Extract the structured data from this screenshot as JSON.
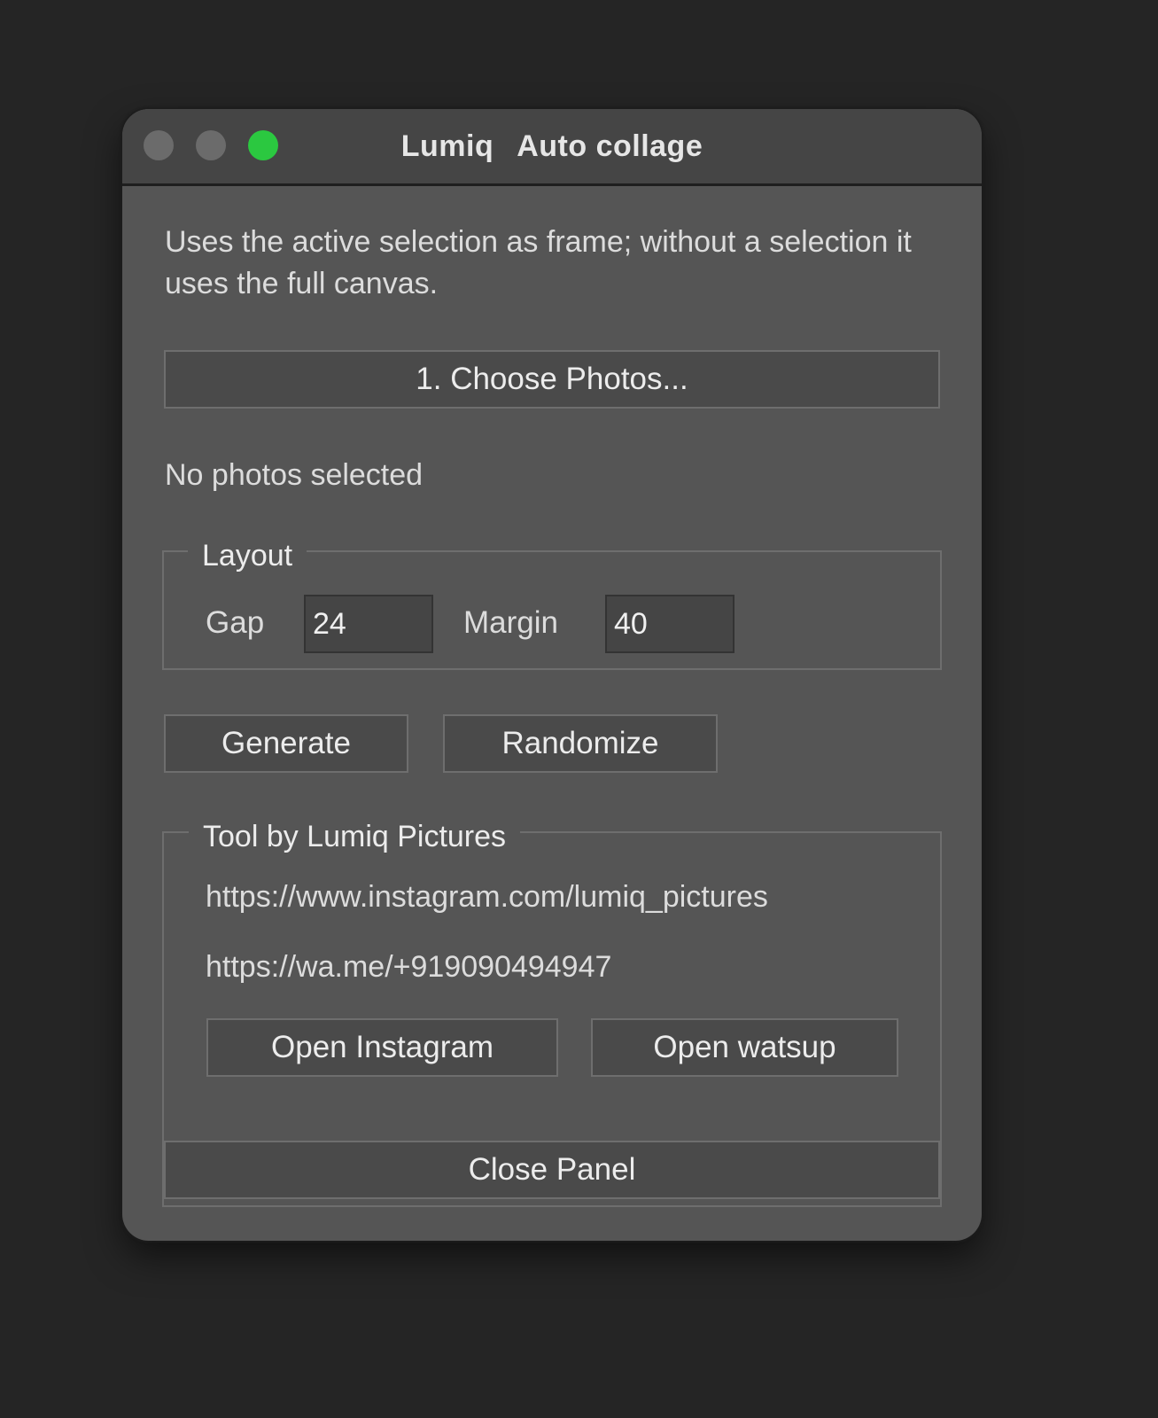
{
  "window": {
    "title_part1": "Lumiq",
    "title_part2": "Auto collage"
  },
  "description": "Uses the active selection as frame; without a selection it uses the full canvas.",
  "choose_button_label": "1. Choose Photos...",
  "status_text": "No photos selected",
  "layout": {
    "legend": "Layout",
    "gap_label": "Gap",
    "gap_value": "24",
    "margin_label": "Margin",
    "margin_value": "40"
  },
  "actions": {
    "generate_label": "Generate",
    "randomize_label": "Randomize"
  },
  "tool": {
    "legend": "Tool by Lumiq Pictures",
    "instagram_url": "https://www.instagram.com/lumiq_pictures",
    "whatsapp_url": "https://wa.me/+919090494947",
    "open_instagram_label": "Open Instagram",
    "open_whatsapp_label": "Open watsup"
  },
  "close_panel_label": "Close Panel",
  "colors": {
    "background": "#252525",
    "panel": "#555555",
    "titlebar": "#454545",
    "zoom_light": "#2bc840",
    "inactive_light": "#6b6b6b"
  }
}
